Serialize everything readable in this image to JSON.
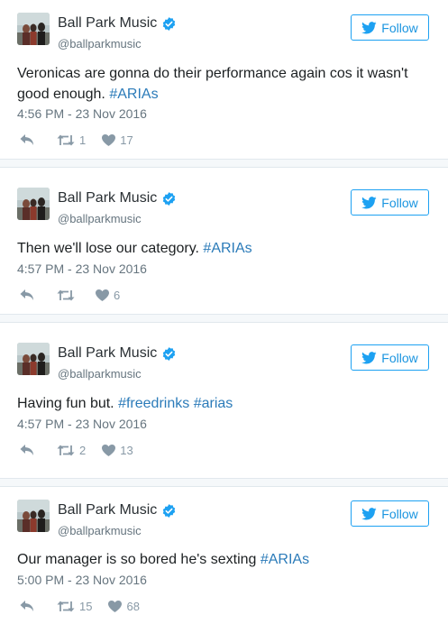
{
  "tweets": [
    {
      "name": "Ball Park Music",
      "handle": "@ballparkmusic",
      "follow_label": "Follow",
      "text_plain": "Veronicas are gonna do their performance again cos it wasn't good enough. ",
      "hashtags": [
        "#ARIAs"
      ],
      "time": "4:56 PM - 23 Nov 2016",
      "retweets": "1",
      "likes": "17"
    },
    {
      "name": "Ball Park Music",
      "handle": "@ballparkmusic",
      "follow_label": "Follow",
      "text_plain": "Then we'll lose our category. ",
      "hashtags": [
        "#ARIAs"
      ],
      "time": "4:57 PM - 23 Nov 2016",
      "retweets": "",
      "likes": "6"
    },
    {
      "name": "Ball Park Music",
      "handle": "@ballparkmusic",
      "follow_label": "Follow",
      "text_plain": "Having fun but. ",
      "hashtags": [
        "#freedrinks",
        "#arias"
      ],
      "time": "4:57 PM - 23 Nov 2016",
      "retweets": "2",
      "likes": "13"
    },
    {
      "name": "Ball Park Music",
      "handle": "@ballparkmusic",
      "follow_label": "Follow",
      "text_plain": "Our manager is so bored he's sexting ",
      "hashtags": [
        "#ARIAs"
      ],
      "time": "5:00 PM - 23 Nov 2016",
      "retweets": "15",
      "likes": "68"
    }
  ],
  "colors": {
    "link": "#2b7bb9",
    "follow_border": "#1da1f2",
    "verified": "#1da1f2",
    "meta": "#66757f",
    "action": "#8899a6",
    "separator": "#f5f8fa"
  },
  "icons": {
    "verified": "verified-badge-icon",
    "bird": "twitter-bird-icon",
    "reply": "reply-icon",
    "retweet": "retweet-icon",
    "like": "heart-icon"
  }
}
